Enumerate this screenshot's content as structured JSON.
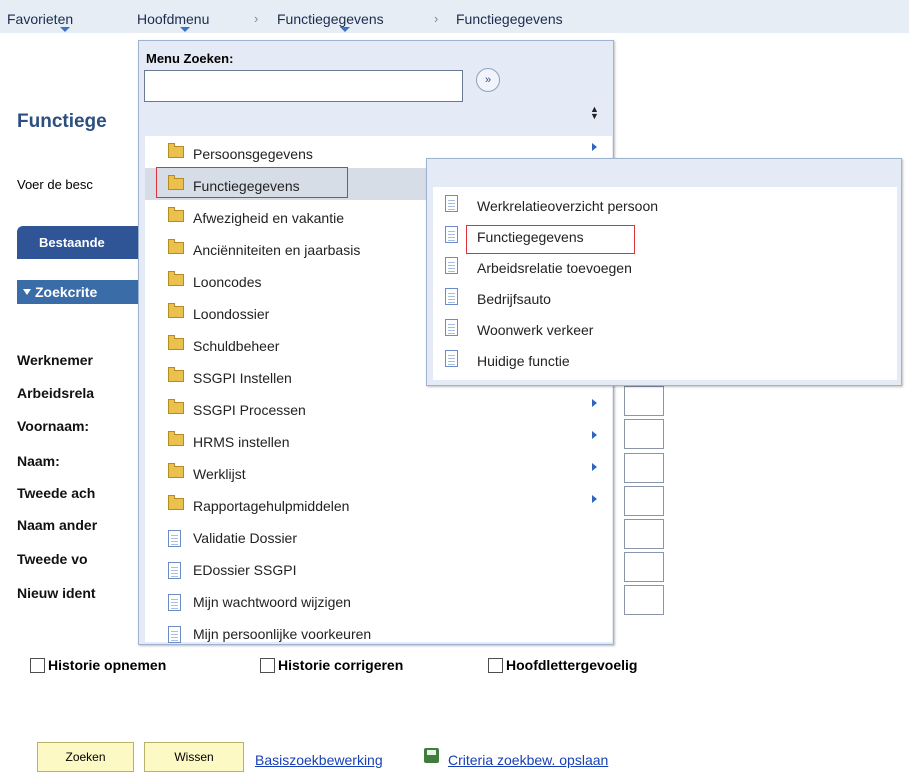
{
  "nav": {
    "favorites": "Favorieten",
    "main_menu": "Hoofdmenu",
    "crumbs": [
      "Functiegegevens",
      "Functiegegevens"
    ]
  },
  "page": {
    "title": "Functiege",
    "instructions": "Voer de besc",
    "tab": "Bestaande",
    "criteria_section": "Zoekcrite",
    "fields": [
      "Werknemer",
      "Arbeidsrela",
      "Voornaam:",
      "Naam:",
      "Tweede ach",
      "Naam ander",
      "Tweede vo",
      "Nieuw ident"
    ],
    "checkboxes": [
      "Historie opnemen",
      "Historie corrigeren",
      "Hoofdlettergevoelig"
    ],
    "buttons": {
      "search": "Zoeken",
      "clear": "Wissen"
    },
    "links": {
      "basic_search": "Basiszoekbewerking",
      "save_criteria": "Criteria zoekbew. opslaan"
    }
  },
  "menu": {
    "search_label": "Menu Zoeken:",
    "search_value": "",
    "go_symbol": "»",
    "sort_symbol": "▲▼",
    "items": [
      {
        "label": "Persoonsgegevens",
        "icon": "folder-icon",
        "submenu": true
      },
      {
        "label": "Functiegegevens",
        "icon": "folder-icon",
        "submenu": false,
        "selected": true
      },
      {
        "label": "Afwezigheid en vakantie",
        "icon": "folder-icon",
        "submenu": false
      },
      {
        "label": "Anciënniteiten en jaarbasis",
        "icon": "folder-icon",
        "submenu": false
      },
      {
        "label": "Looncodes",
        "icon": "folder-icon",
        "submenu": false
      },
      {
        "label": "Loondossier",
        "icon": "folder-icon",
        "submenu": false
      },
      {
        "label": "Schuldbeheer",
        "icon": "folder-icon",
        "submenu": false
      },
      {
        "label": "SSGPI Instellen",
        "icon": "folder-icon",
        "submenu": false
      },
      {
        "label": "SSGPI Processen",
        "icon": "folder-icon",
        "submenu": true
      },
      {
        "label": "HRMS instellen",
        "icon": "folder-icon",
        "submenu": true
      },
      {
        "label": "Werklijst",
        "icon": "folder-icon",
        "submenu": true
      },
      {
        "label": "Rapportagehulpmiddelen",
        "icon": "folder-icon",
        "submenu": true
      },
      {
        "label": "Validatie Dossier",
        "icon": "document-icon",
        "submenu": false
      },
      {
        "label": "EDossier SSGPI",
        "icon": "document-icon",
        "submenu": false
      },
      {
        "label": "Mijn wachtwoord wijzigen",
        "icon": "document-icon",
        "submenu": false
      },
      {
        "label": "Mijn persoonlijke voorkeuren",
        "icon": "document-icon",
        "submenu": false
      }
    ]
  },
  "submenu": {
    "items": [
      {
        "label": "Werkrelatieoverzicht persoon",
        "icon": "document-icon"
      },
      {
        "label": "Functiegegevens",
        "icon": "document-icon",
        "highlighted": true
      },
      {
        "label": "Arbeidsrelatie toevoegen",
        "icon": "document-icon"
      },
      {
        "label": "Bedrijfsauto",
        "icon": "document-icon"
      },
      {
        "label": "Woonwerk verkeer",
        "icon": "document-icon"
      },
      {
        "label": "Huidige functie",
        "icon": "document-icon"
      }
    ]
  },
  "colors": {
    "nav_bg": "#e6edf5",
    "menu_bg": "#e4ebf6",
    "tab_bg": "#2f5596",
    "section_bg": "#3a6ca8",
    "highlight_border": "#e0303a",
    "button_bg": "#fcf9c4",
    "link": "#1740b6"
  }
}
